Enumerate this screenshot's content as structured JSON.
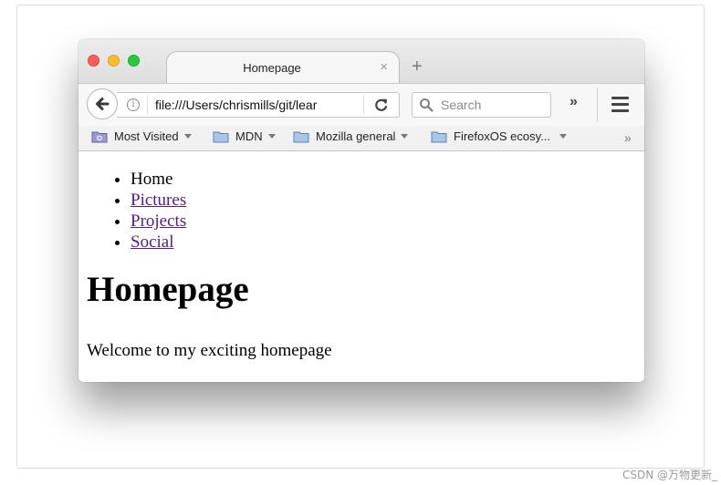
{
  "tab": {
    "title": "Homepage",
    "close_glyph": "×",
    "new_tab_glyph": "+"
  },
  "toolbar": {
    "url": "file:///Users/chrismills/git/lear",
    "search_placeholder": "Search",
    "overflow_glyph": "»"
  },
  "bookmarks": {
    "items": [
      {
        "label": "Most Visited",
        "icon": "smart-folder-icon"
      },
      {
        "label": "MDN",
        "icon": "folder-icon"
      },
      {
        "label": "Mozilla general",
        "icon": "folder-icon"
      },
      {
        "label": "FirefoxOS ecosy...",
        "icon": "folder-icon"
      }
    ],
    "more_glyph": "»"
  },
  "content": {
    "nav": [
      {
        "label": "Home",
        "link": false
      },
      {
        "label": "Pictures",
        "link": true
      },
      {
        "label": "Projects",
        "link": true
      },
      {
        "label": "Social",
        "link": true
      }
    ],
    "heading": "Homepage",
    "paragraph": "Welcome to my exciting homepage"
  },
  "watermark": "CSDN @万物更新_",
  "colors": {
    "close": "#fc5f57",
    "minimize": "#fdbc2e",
    "maximize": "#28c840",
    "link": "#551a8b",
    "folder": "#8fb0d6"
  }
}
